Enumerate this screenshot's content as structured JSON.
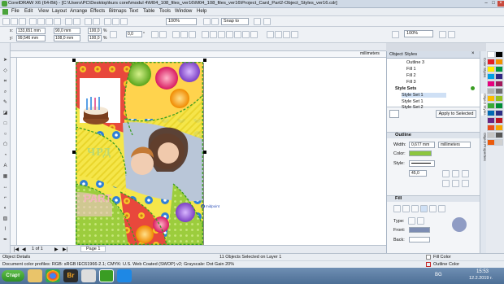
{
  "titlebar": {
    "title": "CorelDRAW X6 (64-Bit) - [C:\\Users\\PC\\Desktop\\kurs corel\\modul 4\\M04_108_files_ver16\\M04_108_files_ver16\\Project_Card_Part2-Object_Styles_ver16.cdr]"
  },
  "menu": [
    "File",
    "Edit",
    "View",
    "Layout",
    "Arrange",
    "Effects",
    "Bitmaps",
    "Text",
    "Table",
    "Tools",
    "Window",
    "Help"
  ],
  "toolbar": {
    "zoom": "100%",
    "snap_to": "Snap to",
    "zoom2": "100%"
  },
  "propbar": {
    "x": "133,651 mm",
    "y": "99,546 mm",
    "w": "90,0 mm",
    "h": "108,0 mm",
    "sx": "100,0",
    "sy": "100,0",
    "pct": "%",
    "angle": "0,0",
    "deg": "°"
  },
  "canvas": {
    "ruler_unit": "millimeters",
    "card_text": "ЧРД",
    "party_text": "PART",
    "midpoint_label": "midpoint"
  },
  "pagenav": {
    "counter": "1  of  1",
    "page_tab": "Page 1"
  },
  "docker": {
    "title": "Object Styles",
    "tree": [
      "Outline 3",
      "Fill 1",
      "Fill 2",
      "Fill 3",
      "Style Sets",
      "Style Set 1",
      "Style Set 1",
      "Style Set 2"
    ],
    "apply_button": "Apply to Selected",
    "outline": {
      "title": "Outline",
      "width_label": "Width:",
      "width_value": "0,677 mm",
      "units": "millimeters",
      "color_label": "Color:",
      "style_label": "Style:",
      "angle_value": "45,0",
      "color": "#8cc63f"
    },
    "fill": {
      "title": "Fill",
      "type_label": "Type:",
      "front_label": "Front:",
      "back_label": "Back:"
    },
    "bottom": {
      "fill_color": "Fill Color",
      "outline_color": "Outline Color"
    }
  },
  "sidetabs": [
    "Color Styles",
    "Object Styles",
    "Object Properties"
  ],
  "palette_colors": [
    "#ffffff",
    "#000000",
    "#e31e24",
    "#f39200",
    "#ffed00",
    "#009640",
    "#00a0e3",
    "#312783",
    "#e6007e",
    "#a3195b",
    "#b1b3b3",
    "#706f6f",
    "#fbba00",
    "#95c11f",
    "#3aaa35",
    "#008d36",
    "#0069b4",
    "#2d2e83",
    "#662483",
    "#be1622",
    "#e94e1b",
    "#f7a600",
    "#c6c6c5",
    "#575756",
    "#ea5b0c",
    "#d0d0d0"
  ],
  "status": {
    "object_details": "Object Details",
    "selection": "11 Objects Selected on Layer 1",
    "profiles": "Document color profiles: RGB: sRGB IEC61966-2.1; CMYK: U.S. Web Coated (SWOP) v2; Grayscale: Dot Gain 20%"
  },
  "taskbar": {
    "start": "Старт",
    "lang": "BG",
    "time": "15:53",
    "date": "12.2.2019 г."
  }
}
